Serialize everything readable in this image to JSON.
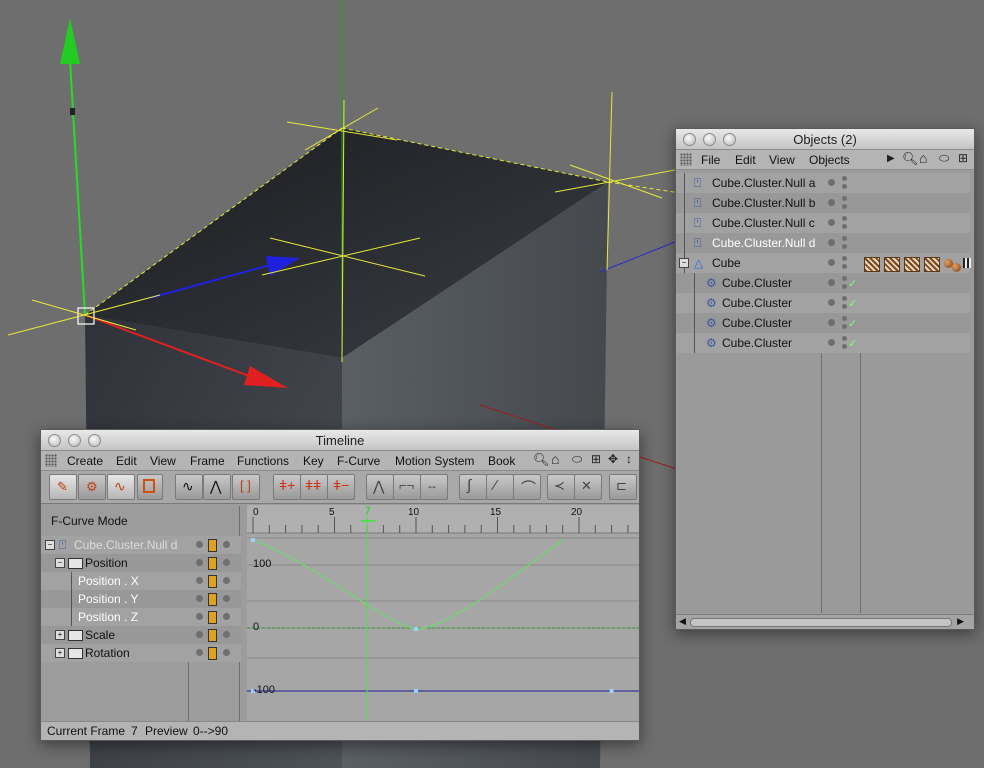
{
  "objects_window": {
    "title": "Objects (2)",
    "menu": [
      "File",
      "Edit",
      "View",
      "Objects"
    ],
    "rows": [
      {
        "name": "Cube.Cluster.Null a",
        "selected": false,
        "indent": 0
      },
      {
        "name": "Cube.Cluster.Null b",
        "selected": false,
        "indent": 0
      },
      {
        "name": "Cube.Cluster.Null c",
        "selected": false,
        "indent": 0
      },
      {
        "name": "Cube.Cluster.Null d",
        "selected": true,
        "indent": 0
      },
      {
        "name": "Cube",
        "selected": false,
        "indent": 0
      },
      {
        "name": "Cube.Cluster",
        "selected": false,
        "indent": 1
      },
      {
        "name": "Cube.Cluster",
        "selected": false,
        "indent": 1
      },
      {
        "name": "Cube.Cluster",
        "selected": false,
        "indent": 1
      },
      {
        "name": "Cube.Cluster",
        "selected": false,
        "indent": 1
      }
    ]
  },
  "timeline_window": {
    "title": "Timeline",
    "menu": [
      "Create",
      "Edit",
      "View",
      "Frame",
      "Functions",
      "Key",
      "F-Curve",
      "Motion System",
      "Book"
    ],
    "mode_label": "F-Curve Mode",
    "tracks": [
      {
        "name": "Cube.Cluster.Null d",
        "level": 0
      },
      {
        "name": "Position",
        "level": 1
      },
      {
        "name": "Position . X",
        "level": 2
      },
      {
        "name": "Position . Y",
        "level": 2
      },
      {
        "name": "Position . Z",
        "level": 2
      },
      {
        "name": "Scale",
        "level": 1
      },
      {
        "name": "Rotation",
        "level": 1
      }
    ],
    "ruler": {
      "ticks": [
        "0",
        "5",
        "10",
        "15",
        "20"
      ],
      "current": "7",
      "current_frame_value": 7
    },
    "y_labels": [
      "100",
      "0",
      "-100"
    ],
    "status": {
      "label": "Current Frame",
      "frame": "7",
      "preview_label": "Preview",
      "preview": "0-->90"
    }
  },
  "colors": {
    "accent_yellow": "#e8e83a",
    "axis_green": "#22dd22",
    "axis_red": "#e02020",
    "axis_blue": "#2020e0",
    "curve_green": "#6fd86f"
  }
}
